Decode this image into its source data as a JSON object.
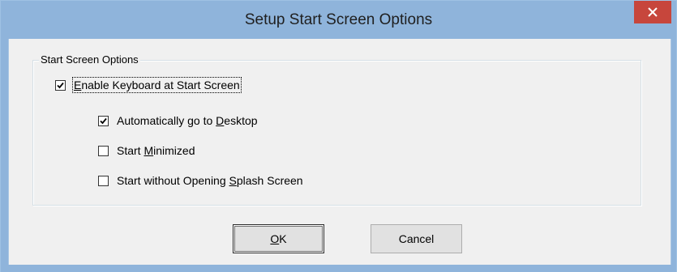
{
  "window": {
    "title": "Setup Start Screen Options",
    "close_icon": "close-icon"
  },
  "group": {
    "legend": "Start Screen Options"
  },
  "options": [
    {
      "label_pre": "",
      "mnemonic": "E",
      "label_post": "nable Keyboard at Start Screen",
      "checked": true
    },
    {
      "label_pre": "Automatically go to ",
      "mnemonic": "D",
      "label_post": "esktop",
      "checked": true
    },
    {
      "label_pre": "Start ",
      "mnemonic": "M",
      "label_post": "inimized",
      "checked": false
    },
    {
      "label_pre": "Start without Opening ",
      "mnemonic": "S",
      "label_post": "plash Screen",
      "checked": false
    }
  ],
  "buttons": {
    "ok": {
      "pre": "",
      "mnemonic": "O",
      "post": "K"
    },
    "cancel": "Cancel"
  },
  "colors": {
    "titlebar": "#8fb4db",
    "close": "#c7463c",
    "dialog_bg": "#f0f0f0"
  }
}
